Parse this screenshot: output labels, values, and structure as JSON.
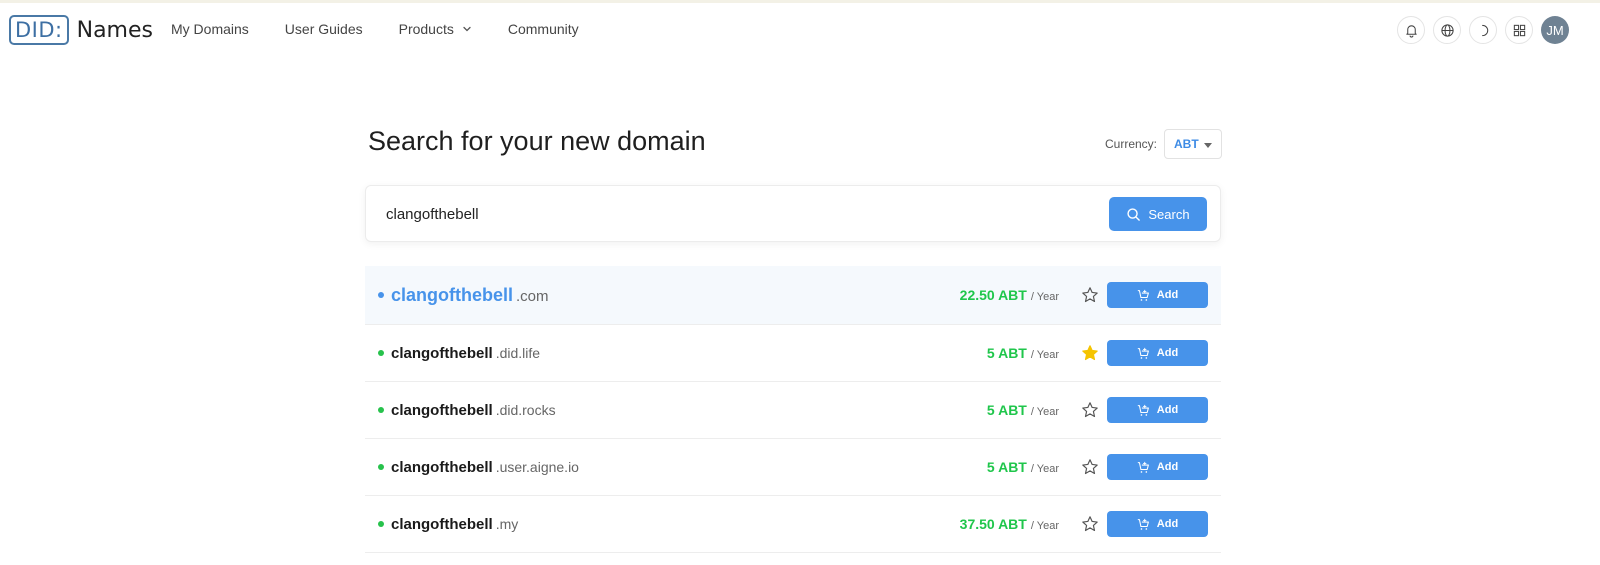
{
  "header": {
    "logo_prefix": "DID:",
    "logo_name": "Names",
    "nav": [
      {
        "label": "My Domains"
      },
      {
        "label": "User Guides"
      },
      {
        "label": "Products"
      },
      {
        "label": "Community"
      }
    ],
    "icons": [
      "bell-icon",
      "globe-icon",
      "moon-icon",
      "apps-grid-icon"
    ],
    "avatar_initials": "JM"
  },
  "main": {
    "title": "Search for your new domain",
    "currency_label": "Currency:",
    "currency_value": "ABT",
    "search_value": "clangofthebell",
    "search_button": "Search"
  },
  "results": [
    {
      "name": "clangofthebell",
      "tld": ".com",
      "price": "22.50 ABT",
      "per": "/ Year",
      "favorited": false,
      "add_label": "Add"
    },
    {
      "name": "clangofthebell",
      "tld": ".did.life",
      "price": "5 ABT",
      "per": "/ Year",
      "favorited": true,
      "add_label": "Add"
    },
    {
      "name": "clangofthebell",
      "tld": ".did.rocks",
      "price": "5 ABT",
      "per": "/ Year",
      "favorited": false,
      "add_label": "Add"
    },
    {
      "name": "clangofthebell",
      "tld": ".user.aigne.io",
      "price": "5 ABT",
      "per": "/ Year",
      "favorited": false,
      "add_label": "Add"
    },
    {
      "name": "clangofthebell",
      "tld": ".my",
      "price": "37.50 ABT",
      "per": "/ Year",
      "favorited": false,
      "add_label": "Add"
    }
  ],
  "colors": {
    "accent": "#4793ea",
    "price_green": "#1fc64b",
    "available_dot": "#27c24c",
    "favorite_star": "#f5c400"
  }
}
